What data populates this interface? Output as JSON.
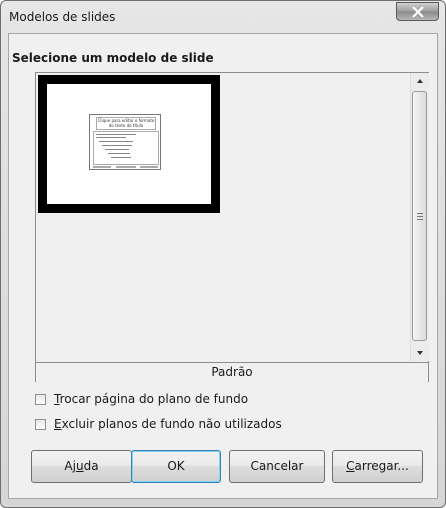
{
  "window": {
    "title": "Modelos de slides"
  },
  "section": {
    "title": "Selecione um modelo de slide"
  },
  "template_list": {
    "items": [
      {
        "label": "Padrão",
        "preview": {
          "title_text": "Clique para editar o formato do texto do título",
          "body_text": "Clique para editar o formato do texto da estrutura de tópicos"
        }
      }
    ]
  },
  "options": {
    "swap_background": {
      "label_pre": "",
      "label_key": "T",
      "label_post": "rocar página do plano de fundo",
      "checked": false
    },
    "delete_unused": {
      "label_pre": "",
      "label_key": "E",
      "label_post": "xcluir planos de fundo não utilizados",
      "checked": false
    }
  },
  "buttons": {
    "help": {
      "pre": "Aj",
      "key": "u",
      "post": "da"
    },
    "ok": "OK",
    "cancel": "Cancelar",
    "load": {
      "pre": "",
      "key": "C",
      "post": "arregar..."
    }
  }
}
